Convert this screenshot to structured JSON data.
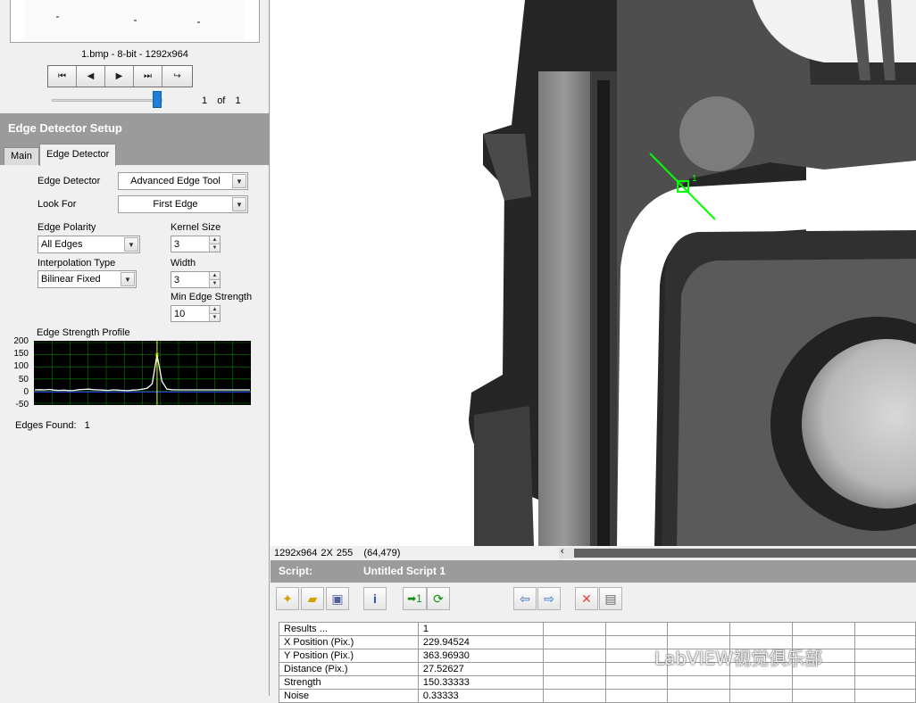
{
  "image_browser": {
    "caption": "1.bmp - 8-bit - 1292x964",
    "page_current": "1",
    "page_of": "of",
    "page_total": "1"
  },
  "setup": {
    "title": "Edge Detector Setup",
    "tabs": [
      "Main",
      "Edge Detector"
    ],
    "edge_detector_label": "Edge Detector",
    "edge_detector_value": "Advanced Edge Tool",
    "look_for_label": "Look For",
    "look_for_value": "First Edge",
    "edge_polarity_label": "Edge Polarity",
    "edge_polarity_value": "All Edges",
    "kernel_size_label": "Kernel Size",
    "kernel_size_value": "3",
    "interpolation_label": "Interpolation Type",
    "interpolation_value": "Bilinear Fixed",
    "width_label": "Width",
    "width_value": "3",
    "min_strength_label": "Min Edge Strength",
    "min_strength_value": "10",
    "profile_label": "Edge Strength Profile",
    "y_ticks": [
      "200",
      "150",
      "100",
      "50",
      "0",
      "-50"
    ],
    "edges_found_label": "Edges Found:",
    "edges_found_value": "1"
  },
  "chart_data": {
    "type": "line",
    "ylim": [
      -50,
      200
    ],
    "series": [
      {
        "values": [
          5,
          6,
          5,
          7,
          4,
          3,
          4,
          2,
          3,
          6,
          7,
          8,
          6,
          5,
          4,
          3,
          5,
          4,
          3,
          2,
          4,
          5,
          8,
          12,
          30,
          150,
          40,
          8,
          6,
          5,
          5,
          5,
          5,
          5,
          5,
          5,
          5,
          5,
          5,
          5,
          5,
          5,
          5,
          5,
          5
        ]
      }
    ],
    "edge_marker_index": 25,
    "color": "#ffffff",
    "marker_color": "#ffff00",
    "grid": true,
    "grid_color": "#008000"
  },
  "viewer": {
    "overlay_label": "1",
    "overlay_color": "#00ff00"
  },
  "status": {
    "image_info": "1292x964 2X 255",
    "coordinates": "(64,479)"
  },
  "script": {
    "label": "Script:",
    "name": "Untitled Script 1"
  },
  "toolbar_icons": [
    "new-script-icon",
    "open-script-icon",
    "save-script-icon",
    "info-icon",
    "run-once-icon",
    "run-script-icon",
    "step-back-icon",
    "step-forward-icon",
    "delete-step-icon",
    "performance-meter-icon"
  ],
  "results": {
    "header": [
      "Results ...",
      "1"
    ],
    "rows": [
      [
        "X Position (Pix.)",
        "229.94524"
      ],
      [
        "Y Position (Pix.)",
        "363.96930"
      ],
      [
        "Distance (Pix.)",
        "27.52627"
      ],
      [
        "Strength",
        "150.33333"
      ],
      [
        "Noise",
        "0.33333"
      ]
    ]
  },
  "watermark": "LabVIEW视觉俱乐部"
}
